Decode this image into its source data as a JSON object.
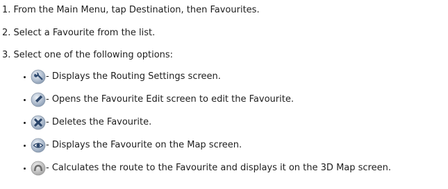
{
  "steps": [
    "1. From the Main Menu, tap Destination, then Favourites.",
    "2. Select a Favourite from the list.",
    "3. Select one of the following options:"
  ],
  "options": [
    {
      "icon": "wrench-icon",
      "text": "- Displays the Routing Settings screen."
    },
    {
      "icon": "pencil-icon",
      "text": "- Opens the Favourite Edit screen to edit the Favourite."
    },
    {
      "icon": "delete-x-icon",
      "text": "- Deletes the Favourite."
    },
    {
      "icon": "eye-icon",
      "text": "- Displays the Favourite on the Map screen."
    },
    {
      "icon": "route-arch-icon",
      "text": "- Calculates the route to the Favourite and displays it on the 3D Map screen."
    }
  ]
}
